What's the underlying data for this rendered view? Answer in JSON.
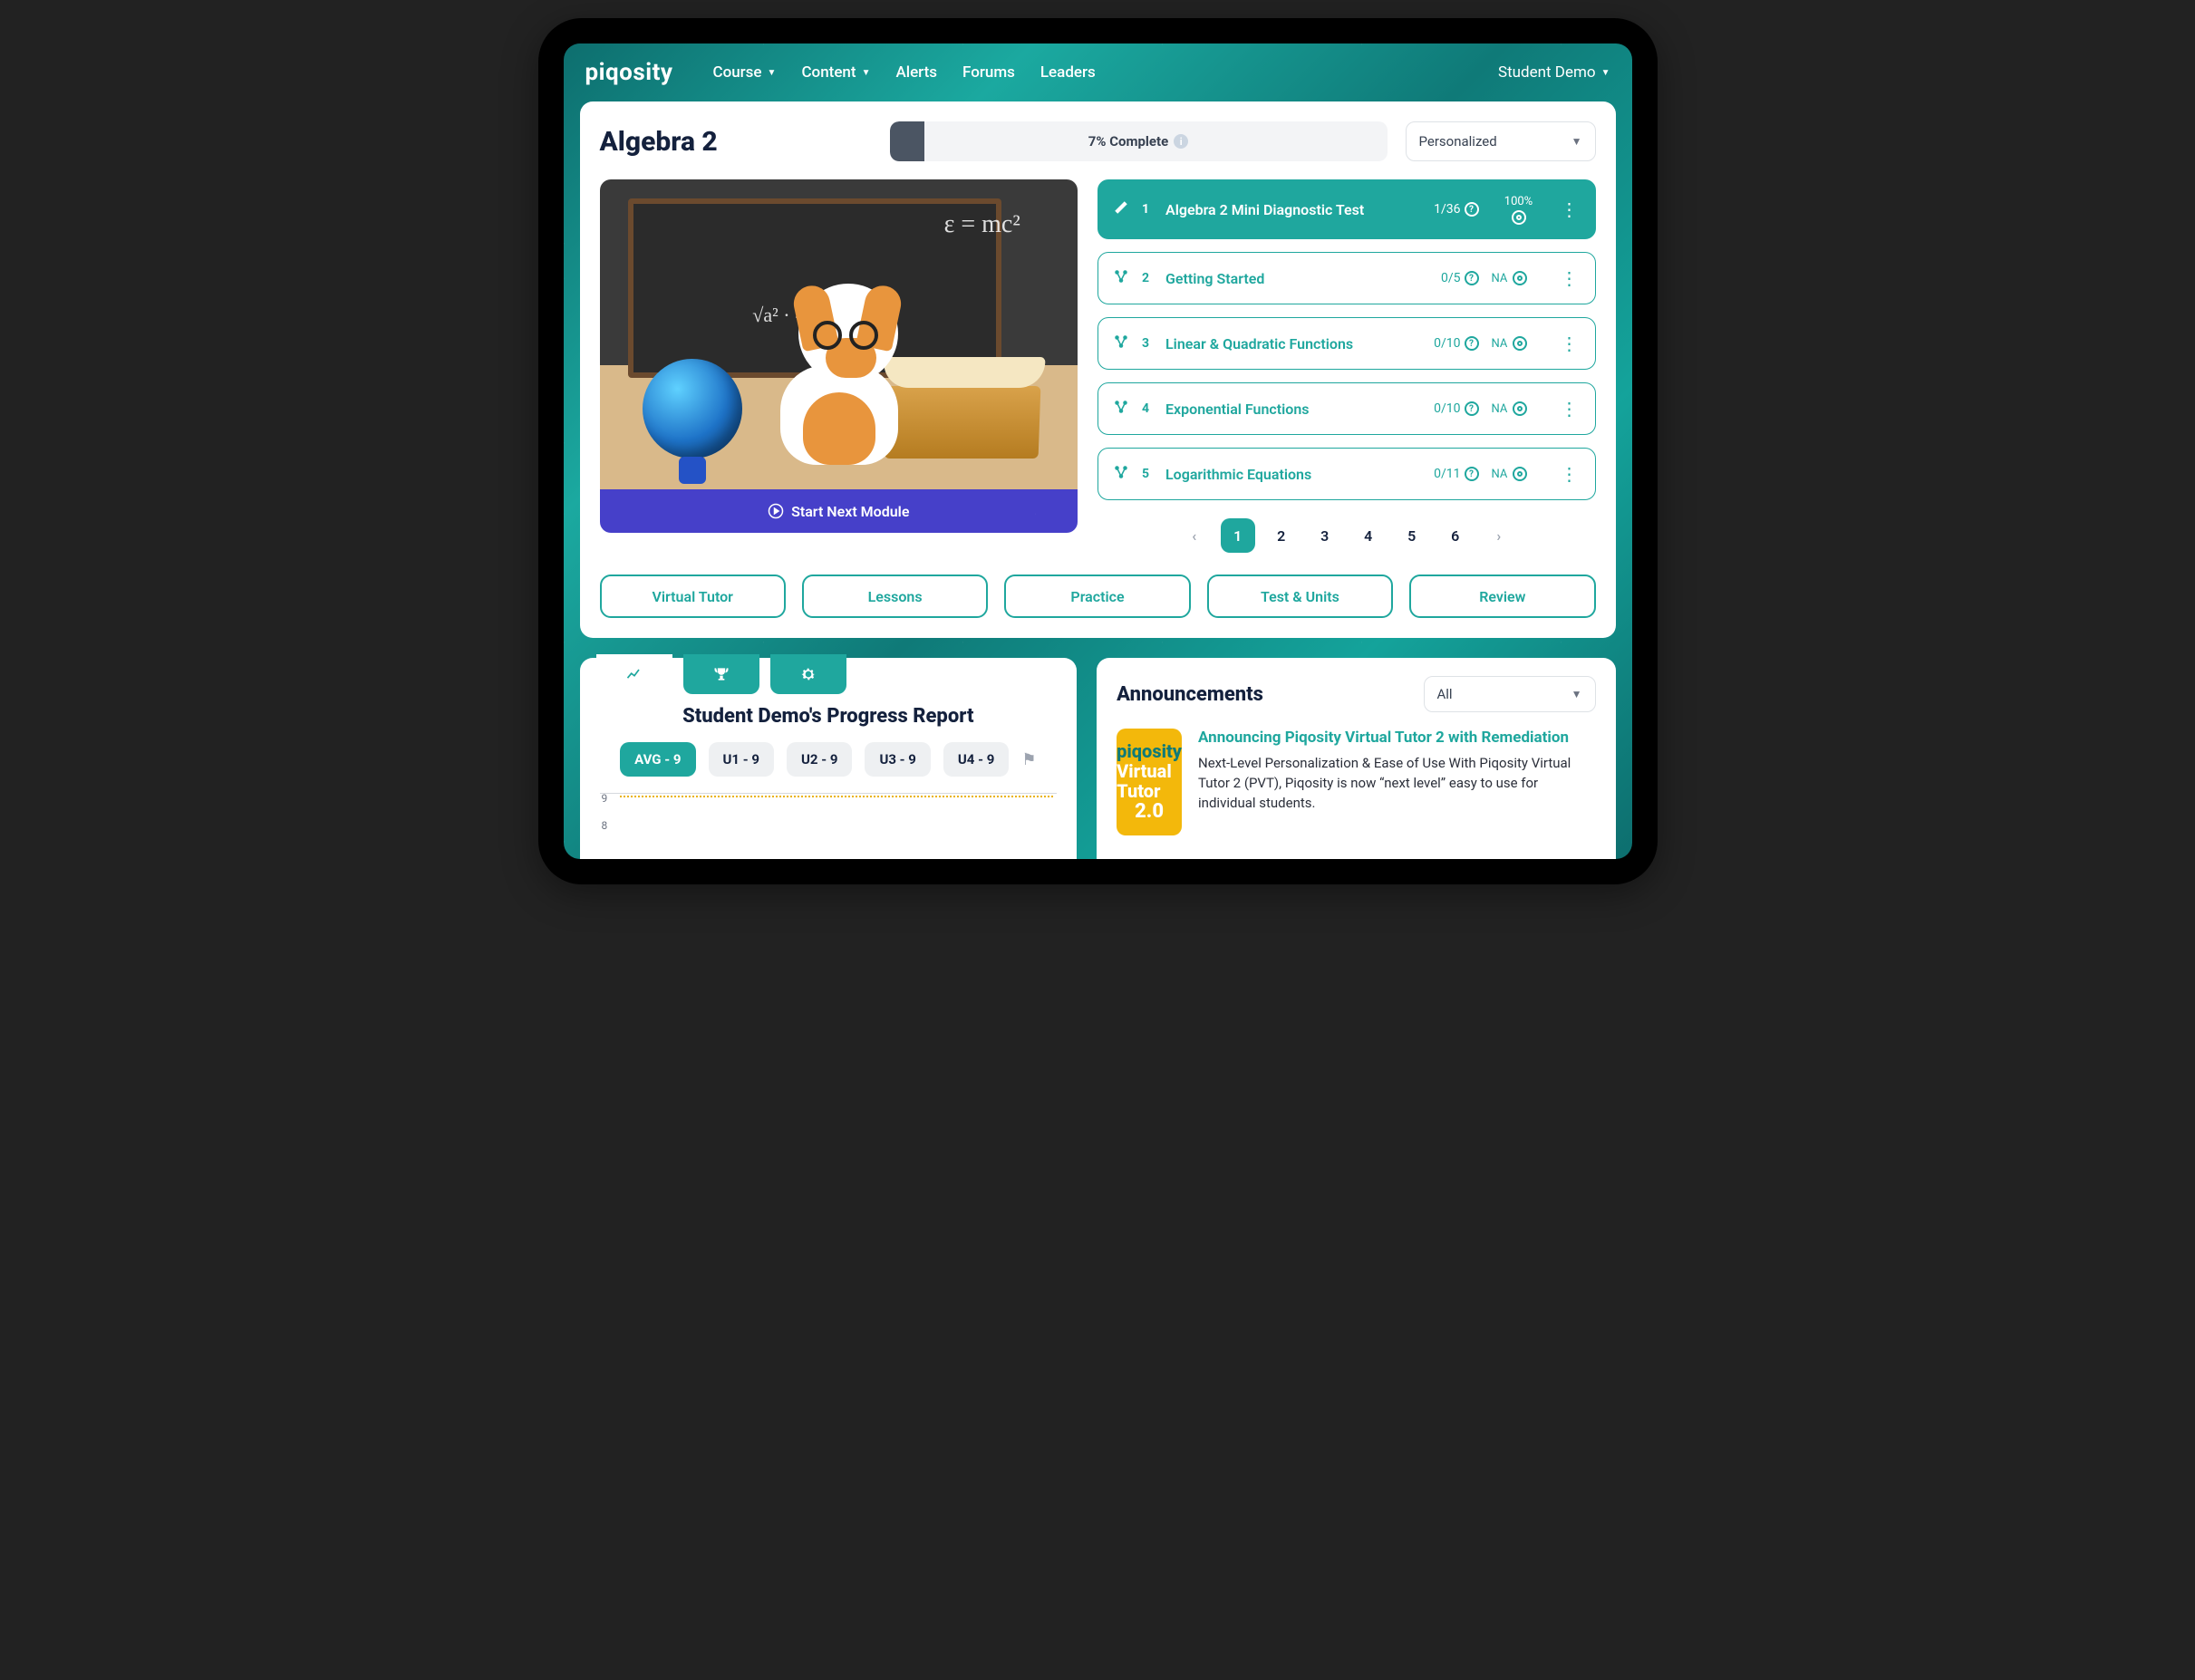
{
  "brand": "piqosity",
  "nav": {
    "items": [
      "Course",
      "Content",
      "Alerts",
      "Forums",
      "Leaders"
    ],
    "user": "Student Demo"
  },
  "course": {
    "title": "Algebra 2",
    "progress_label": "7% Complete",
    "mode_selected": "Personalized",
    "start_button": "Start Next Module"
  },
  "modules": [
    {
      "num": "1",
      "title": "Algebra 2 Mini Diagnostic Test",
      "frac": "1/36",
      "score": "100%",
      "active": true
    },
    {
      "num": "2",
      "title": "Getting Started",
      "frac": "0/5",
      "score": "NA",
      "active": false
    },
    {
      "num": "3",
      "title": "Linear & Quadratic Functions",
      "frac": "0/10",
      "score": "NA",
      "active": false
    },
    {
      "num": "4",
      "title": "Exponential Functions",
      "frac": "0/10",
      "score": "NA",
      "active": false
    },
    {
      "num": "5",
      "title": "Logarithmic Equations",
      "frac": "0/11",
      "score": "NA",
      "active": false
    }
  ],
  "pager": [
    "1",
    "2",
    "3",
    "4",
    "5",
    "6"
  ],
  "tabs": [
    "Virtual Tutor",
    "Lessons",
    "Practice",
    "Test & Units",
    "Review"
  ],
  "report": {
    "title": "Student Demo's Progress Report",
    "chips": [
      "AVG - 9",
      "U1 - 9",
      "U2 - 9",
      "U3 - 9",
      "U4 - 9"
    ],
    "y_ticks": [
      "9",
      "8"
    ]
  },
  "announcements": {
    "heading": "Announcements",
    "filter": "All",
    "badge": {
      "l1": "piqosity",
      "l2": "Virtual Tutor",
      "l3": "2.0"
    },
    "item": {
      "title": "Announcing Piqosity Virtual Tutor 2 with Remediation",
      "body": "Next-Level Personalization & Ease of Use With Piqosity Virtual Tutor 2 (PVT), Piqosity is now “next level” easy to use for individual students."
    }
  },
  "chart_data": {
    "type": "line",
    "title": "Student Demo's Progress Report",
    "series": [
      {
        "name": "AVG",
        "values": [
          9
        ]
      }
    ],
    "ylim": [
      8,
      9
    ],
    "y_ticks": [
      9,
      8
    ]
  }
}
